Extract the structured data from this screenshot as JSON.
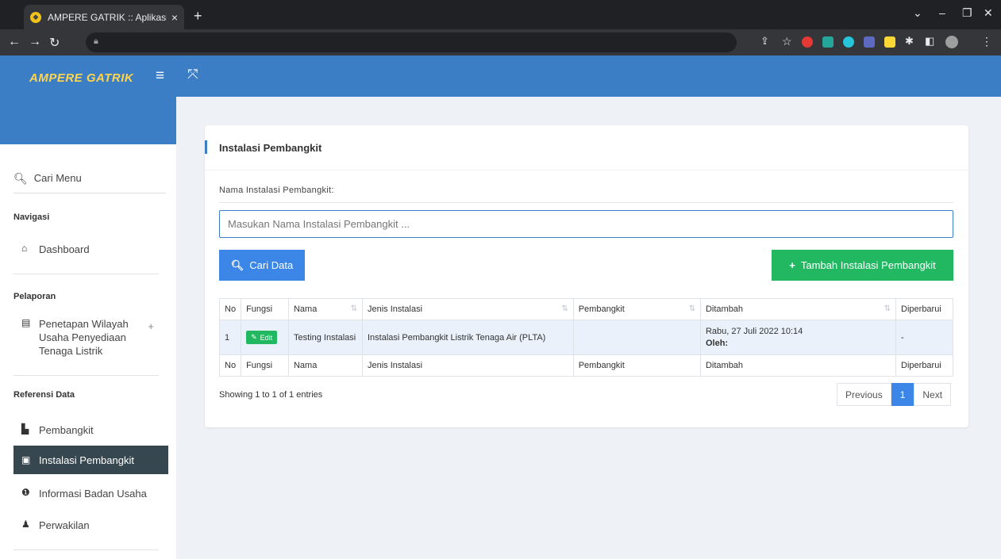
{
  "browser": {
    "tab_title": "AMPERE GATRIK :: Aplikasi Mana",
    "tab_close": "×",
    "new_tab": "+",
    "controls": {
      "chevron": "⌄",
      "minimize": "–",
      "restore": "❐",
      "close": "✕"
    }
  },
  "app": {
    "brand": "AMPERE GATRIK",
    "menu_icon": "≡",
    "expand_icon": "⤧"
  },
  "sidebar": {
    "search_label": "Cari Menu",
    "sections": {
      "navigasi": "Navigasi",
      "pelaporan": "Pelaporan",
      "referensi": "Referensi Data"
    },
    "items": {
      "dashboard": "Dashboard",
      "penetapan": "Penetapan Wilayah Usaha Penyediaan Tenaga Listrik",
      "pembangkit": "Pembangkit",
      "instalasi": "Instalasi Pembangkit",
      "informasi": "Informasi Badan Usaha",
      "perwakilan": "Perwakilan"
    },
    "expand_symbol": "+"
  },
  "main": {
    "title": "Instalasi Pembangkit",
    "field_label": "Nama Instalasi Pembangkit:",
    "search_placeholder": "Masukan Nama Instalasi Pembangkit ...",
    "search_button": "Cari Data",
    "add_button": "Tambah Instalasi Pembangkit",
    "table": {
      "headers": [
        "No",
        "Fungsi",
        "Nama",
        "Jenis Instalasi",
        "Pembangkit",
        "Ditambah",
        "Diperbarui"
      ],
      "rows": [
        {
          "no": "1",
          "fungsi": "Edit",
          "nama": "Testing Instalasi",
          "jenis": "Instalasi Pembangkit Listrik Tenaga Air (PLTA)",
          "pembangkit": "",
          "ditambah_date": "Rabu, 27 Juli 2022 10:14",
          "ditambah_by": "Oleh:",
          "diperbarui": "-"
        }
      ]
    },
    "info": "Showing 1 to 1 of 1 entries",
    "pagination": {
      "previous": "Previous",
      "current": "1",
      "next": "Next"
    }
  },
  "colors": {
    "header_blue": "#3b7ec5",
    "brand_yellow": "#ffd54f",
    "primary_button": "#3b86e6",
    "success_button": "#21b861",
    "sidebar_active": "#37474f"
  }
}
